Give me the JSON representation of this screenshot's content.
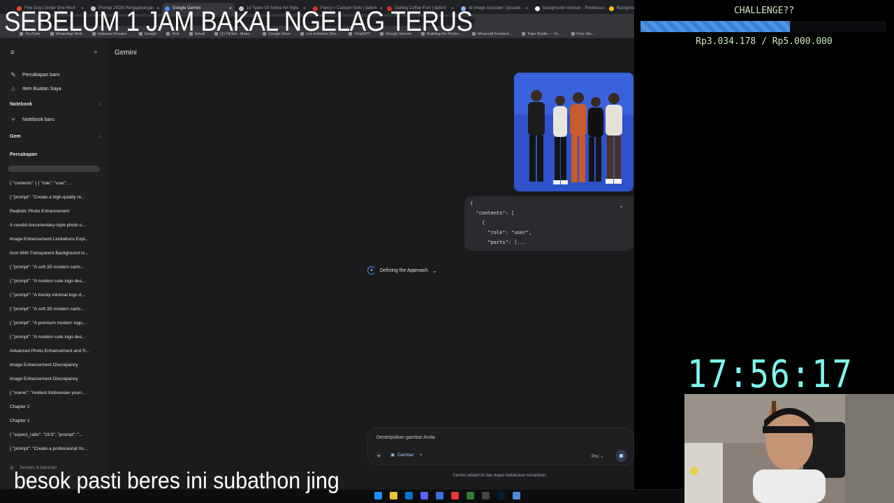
{
  "overlay": {
    "headline": "SEBELUM 1 JAM BAKAL NGELAG TERUS",
    "challenge_title": "CHALLENGE??",
    "challenge_amount": "Rp3.034.178 / Rp5.000.000",
    "challenge_progress": 0.6068,
    "clock": "17:56:17",
    "caption": "besok pasti beres ini subathon jing"
  },
  "browser": {
    "tabs": [
      {
        "label": "Five Guys Under One Roof",
        "color": "#ff3b30"
      },
      {
        "label": "Prompt JSON Penggabungan",
        "color": "#c4c7c5"
      },
      {
        "label": "Google Gemini",
        "color": "#4a8ff0",
        "active": true
      },
      {
        "label": "10 Types Of Anime Art Style",
        "color": "#c4c7c5"
      },
      {
        "label": "Fancy > Cartoon fonts | dafont",
        "color": "#d93025"
      },
      {
        "label": "Darling Coffee Font | dafont",
        "color": "#d93025"
      },
      {
        "label": "AI Image Upscaler: Upscale",
        "color": "#8ab4f8"
      },
      {
        "label": "background remover - Penelusuran",
        "color": "#ffffff"
      },
      {
        "label": "Background",
        "color": "#fbbc04"
      }
    ],
    "bookmarks": [
      "YouTube",
      "WhatsApp Web",
      "Halaman Kreator -",
      "Google",
      "Kick",
      "Gmail",
      "(1) TikTok - Make...",
      "Google Drive",
      "List of Anime Sho...",
      "ChatGPT",
      "Google Gemini",
      "Building the Perfec...",
      "Minecraft Enchant...",
      "Tripo Studio — Yo...",
      "Free Sto..."
    ]
  },
  "sidebar": {
    "new_chat": "Percakapan baru",
    "my_items": "Item Buatan Saya",
    "notebook_section": "Notebook",
    "new_notebook": "Notebook baru",
    "gem_section": "Gem",
    "chats_section": "Percakapan",
    "chats": [
      "{  \"contents\": [    {      \"role\": \"user\",  ...",
      "{  \"prompt\": \"Create a high-quality re...",
      "Realistic Photo Enhancement",
      "A candid documentary-style photo o...",
      "Image Enhancement Limitations Expl...",
      "Icon With Transparent Background Is...",
      "{  \"prompt\": \"A soft 3D modern carto...",
      "{  \"prompt\": \"A modern cute logo des...",
      "{  \"prompt\": \"A trendy minimal logo d...",
      "{  \"prompt\": \"A soft 3D modern carto...",
      "{  \"prompt\": \"A premium modern logo...",
      "{  \"prompt\": \"A modern cute logo des...",
      "Advanced Photo Enhancement and R...",
      "Image Enhancement Discrepancy",
      "Image Enhancement Discrepancy",
      "{  \"scene\": \"modest Indonesian youn...",
      "Chapter 2",
      "Chapter 1",
      "{  \"aspect_ratio\": \"16:9\",  \"prompt\": \"...",
      "{ \"prompt\": \"Create a professional Yo..."
    ],
    "settings": "Setelan & bantuan"
  },
  "main": {
    "title": "Gemini",
    "user_message_lines": [
      "{",
      "  \"contents\": [",
      "    {",
      "      \"role\": \"user\",",
      "      \"parts\": [..."
    ],
    "thinking_label": "Defining the Approach",
    "prompt_placeholder": "Deskripsikan gambar Anda",
    "chip_label": "Gambar",
    "model_label": "Pro",
    "disclaimer": "Gemini adalah AI dan dapat melakukan kesalahan."
  }
}
